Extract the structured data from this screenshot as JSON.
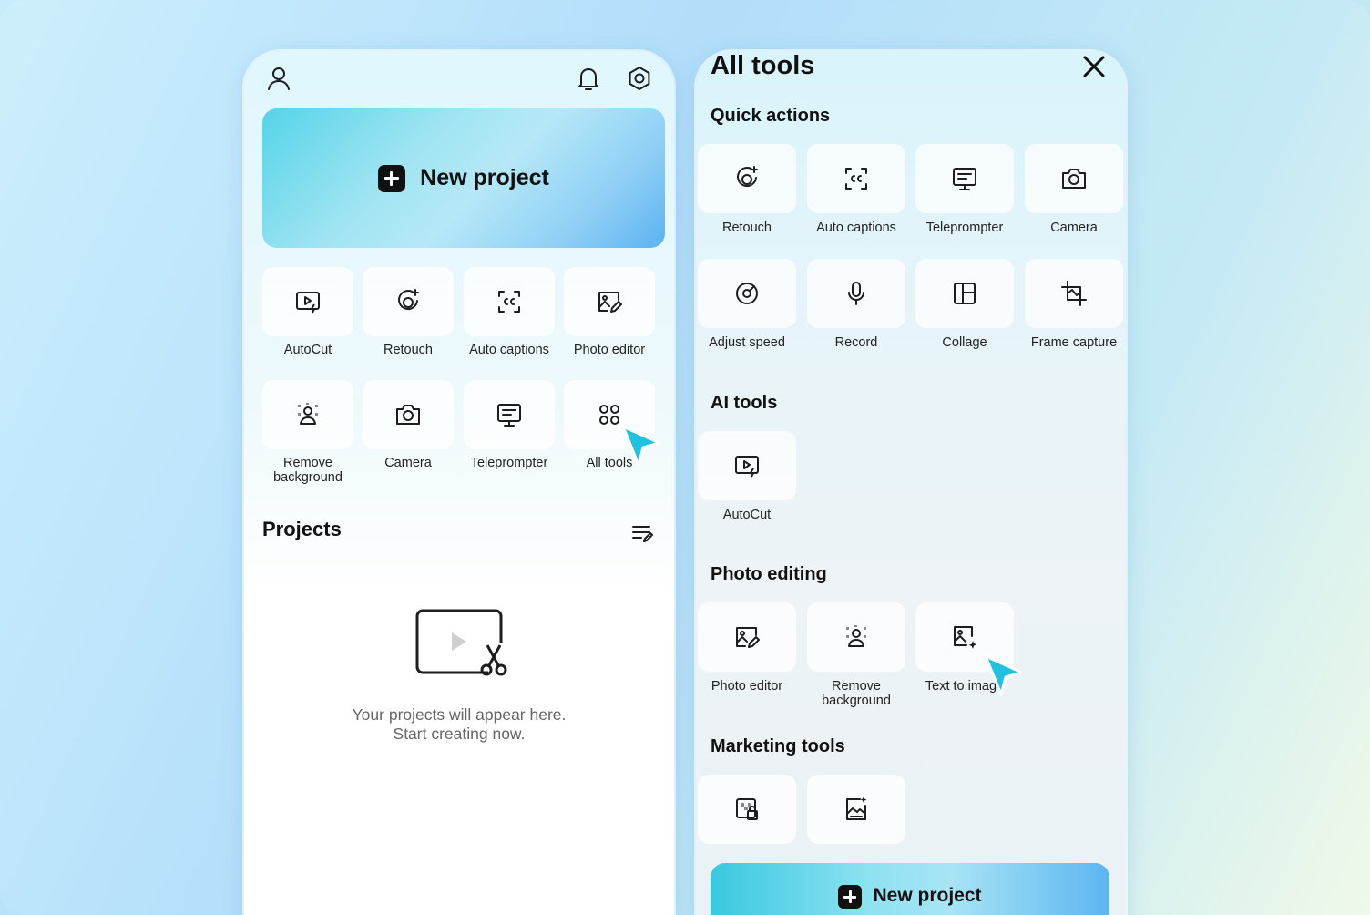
{
  "home": {
    "new_project_label": "New project",
    "tools": [
      {
        "label": "AutoCut",
        "icon": "autocut-icon"
      },
      {
        "label": "Retouch",
        "icon": "retouch-icon"
      },
      {
        "label": "Auto captions",
        "icon": "captions-icon"
      },
      {
        "label": "Photo editor",
        "icon": "photo-editor-icon"
      },
      {
        "label": "Remove background",
        "icon": "remove-background-icon"
      },
      {
        "label": "Camera",
        "icon": "camera-icon"
      },
      {
        "label": "Teleprompter",
        "icon": "teleprompter-icon"
      },
      {
        "label": "All tools",
        "icon": "all-tools-icon"
      }
    ],
    "projects_title": "Projects",
    "empty_line1": "Your projects will appear here.",
    "empty_line2": "Start creating now."
  },
  "all_tools": {
    "title": "All tools",
    "sections": {
      "quick_actions": {
        "title": "Quick actions",
        "items": [
          "Retouch",
          "Auto captions",
          "Teleprompter",
          "Camera",
          "Adjust speed",
          "Record",
          "Collage",
          "Frame capture"
        ]
      },
      "ai_tools": {
        "title": "AI tools",
        "items": [
          "AutoCut"
        ]
      },
      "photo_editing": {
        "title": "Photo editing",
        "items": [
          "Photo editor",
          "Remove background",
          "Text to image"
        ]
      },
      "marketing_tools": {
        "title": "Marketing tools"
      }
    },
    "new_project_label": "New project"
  },
  "colors": {
    "accent": "#27c4e6",
    "cursor": "#1fc0e0"
  }
}
